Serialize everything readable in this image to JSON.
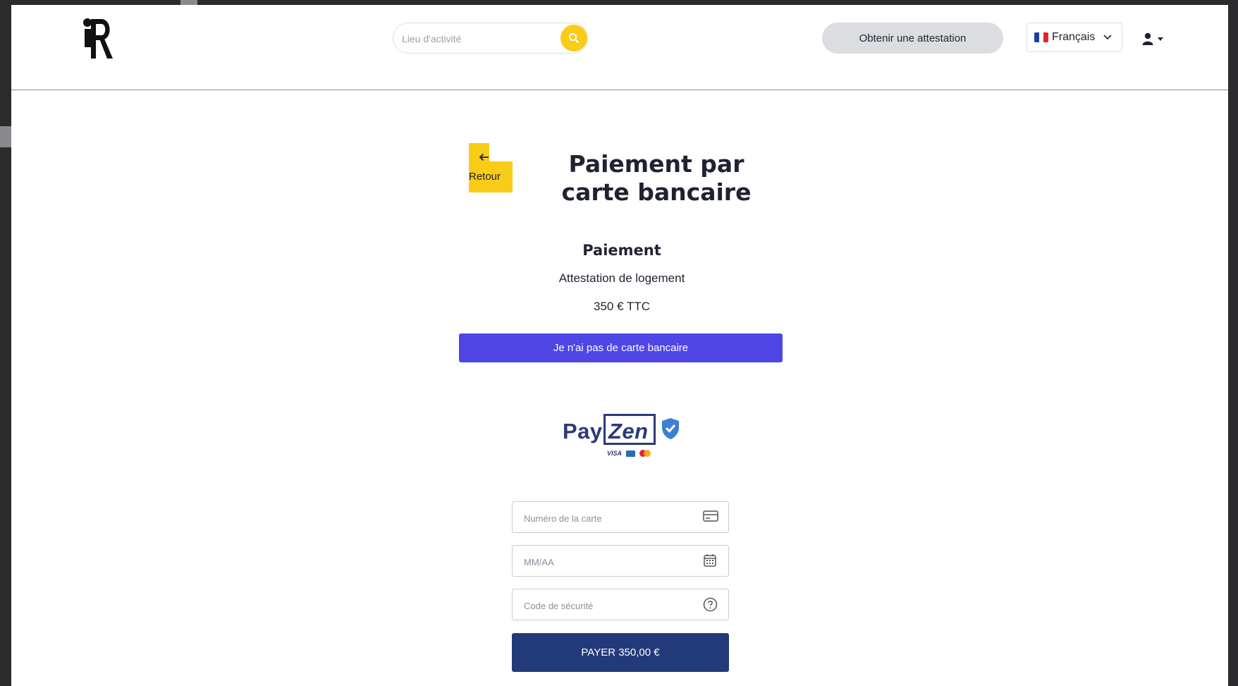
{
  "header": {
    "search": {
      "placeholder": "Lieu d'activité",
      "icon": "search-icon"
    },
    "cta_label": "Obtenir une attestation",
    "language": {
      "flag": "fr-flag",
      "selected": "Français"
    },
    "user_icon": "user-icon"
  },
  "content": {
    "back": {
      "label": "Retour",
      "icon": "arrow-left-icon"
    },
    "title": "Paiement par carte bancaire",
    "section_title": "Paiement",
    "product": "Attestation de logement",
    "price": "350 € TTC",
    "no_card_label": "Je n'ai pas de carte bancaire"
  },
  "payment": {
    "brand": {
      "pay": "Pay",
      "zen": "Zen",
      "visa": "VISA"
    },
    "card_number_placeholder": "Numéro de la carte",
    "expiry_placeholder": "MM/AA",
    "cvv_placeholder": "Code de sécurité",
    "pay_label": "PAYER 350,00 €"
  },
  "colors": {
    "accent_yellow": "#f9cc18",
    "button_indigo": "#4f46e5",
    "pay_navy": "#233a7a",
    "payzen_navy": "#2b3a78",
    "payzen_shield_blue": "#3d7fd1"
  }
}
